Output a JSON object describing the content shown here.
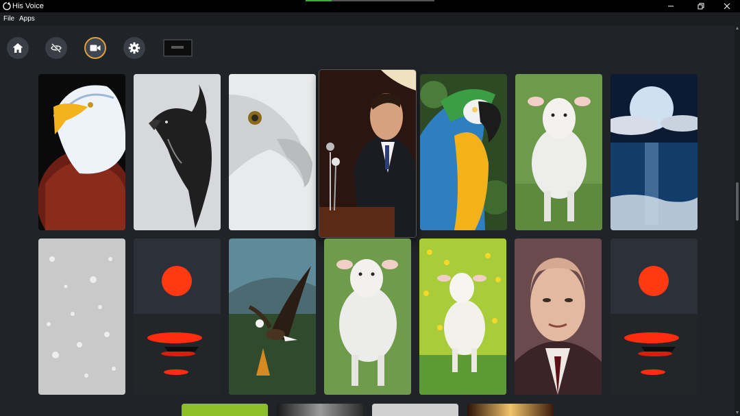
{
  "app": {
    "title": "His Voice",
    "icon": "app-logo-icon",
    "title_progress": 0.2
  },
  "window_controls": {
    "minimize": "minimize-icon",
    "maximize": "restore-icon",
    "close": "close-icon"
  },
  "menu": {
    "items": [
      "File",
      "Apps"
    ]
  },
  "toolbar": {
    "buttons": [
      {
        "name": "home",
        "icon": "home-icon"
      },
      {
        "name": "hide",
        "icon": "eye-slash-icon"
      },
      {
        "name": "video",
        "icon": "video-camera-icon",
        "active": true
      },
      {
        "name": "settings",
        "icon": "gear-icon"
      }
    ],
    "screen_thumbnail": "screen-preview"
  },
  "gallery": {
    "rows": [
      [
        "bald-eagle-head",
        "ink-eagle-sketch",
        "white-eagle-closeup",
        "preacher-at-pulpit",
        "blue-gold-macaw",
        "white-lamb-standing",
        "full-moon-over-sea"
      ],
      [
        "water-droplets",
        "red-sun-boat",
        "eagle-in-flight",
        "white-lamb-grass",
        "lamb-in-flower-field",
        "man-in-suit-portrait",
        "red-sun-boat"
      ]
    ],
    "partial_row": [
      "green-field",
      "light-glow",
      "portrait-partial",
      "warm-light"
    ]
  },
  "colors": {
    "background": "#202327",
    "titlebar": "#000000",
    "accent_active": "#e0a23a",
    "progress": "#3fae3f"
  }
}
